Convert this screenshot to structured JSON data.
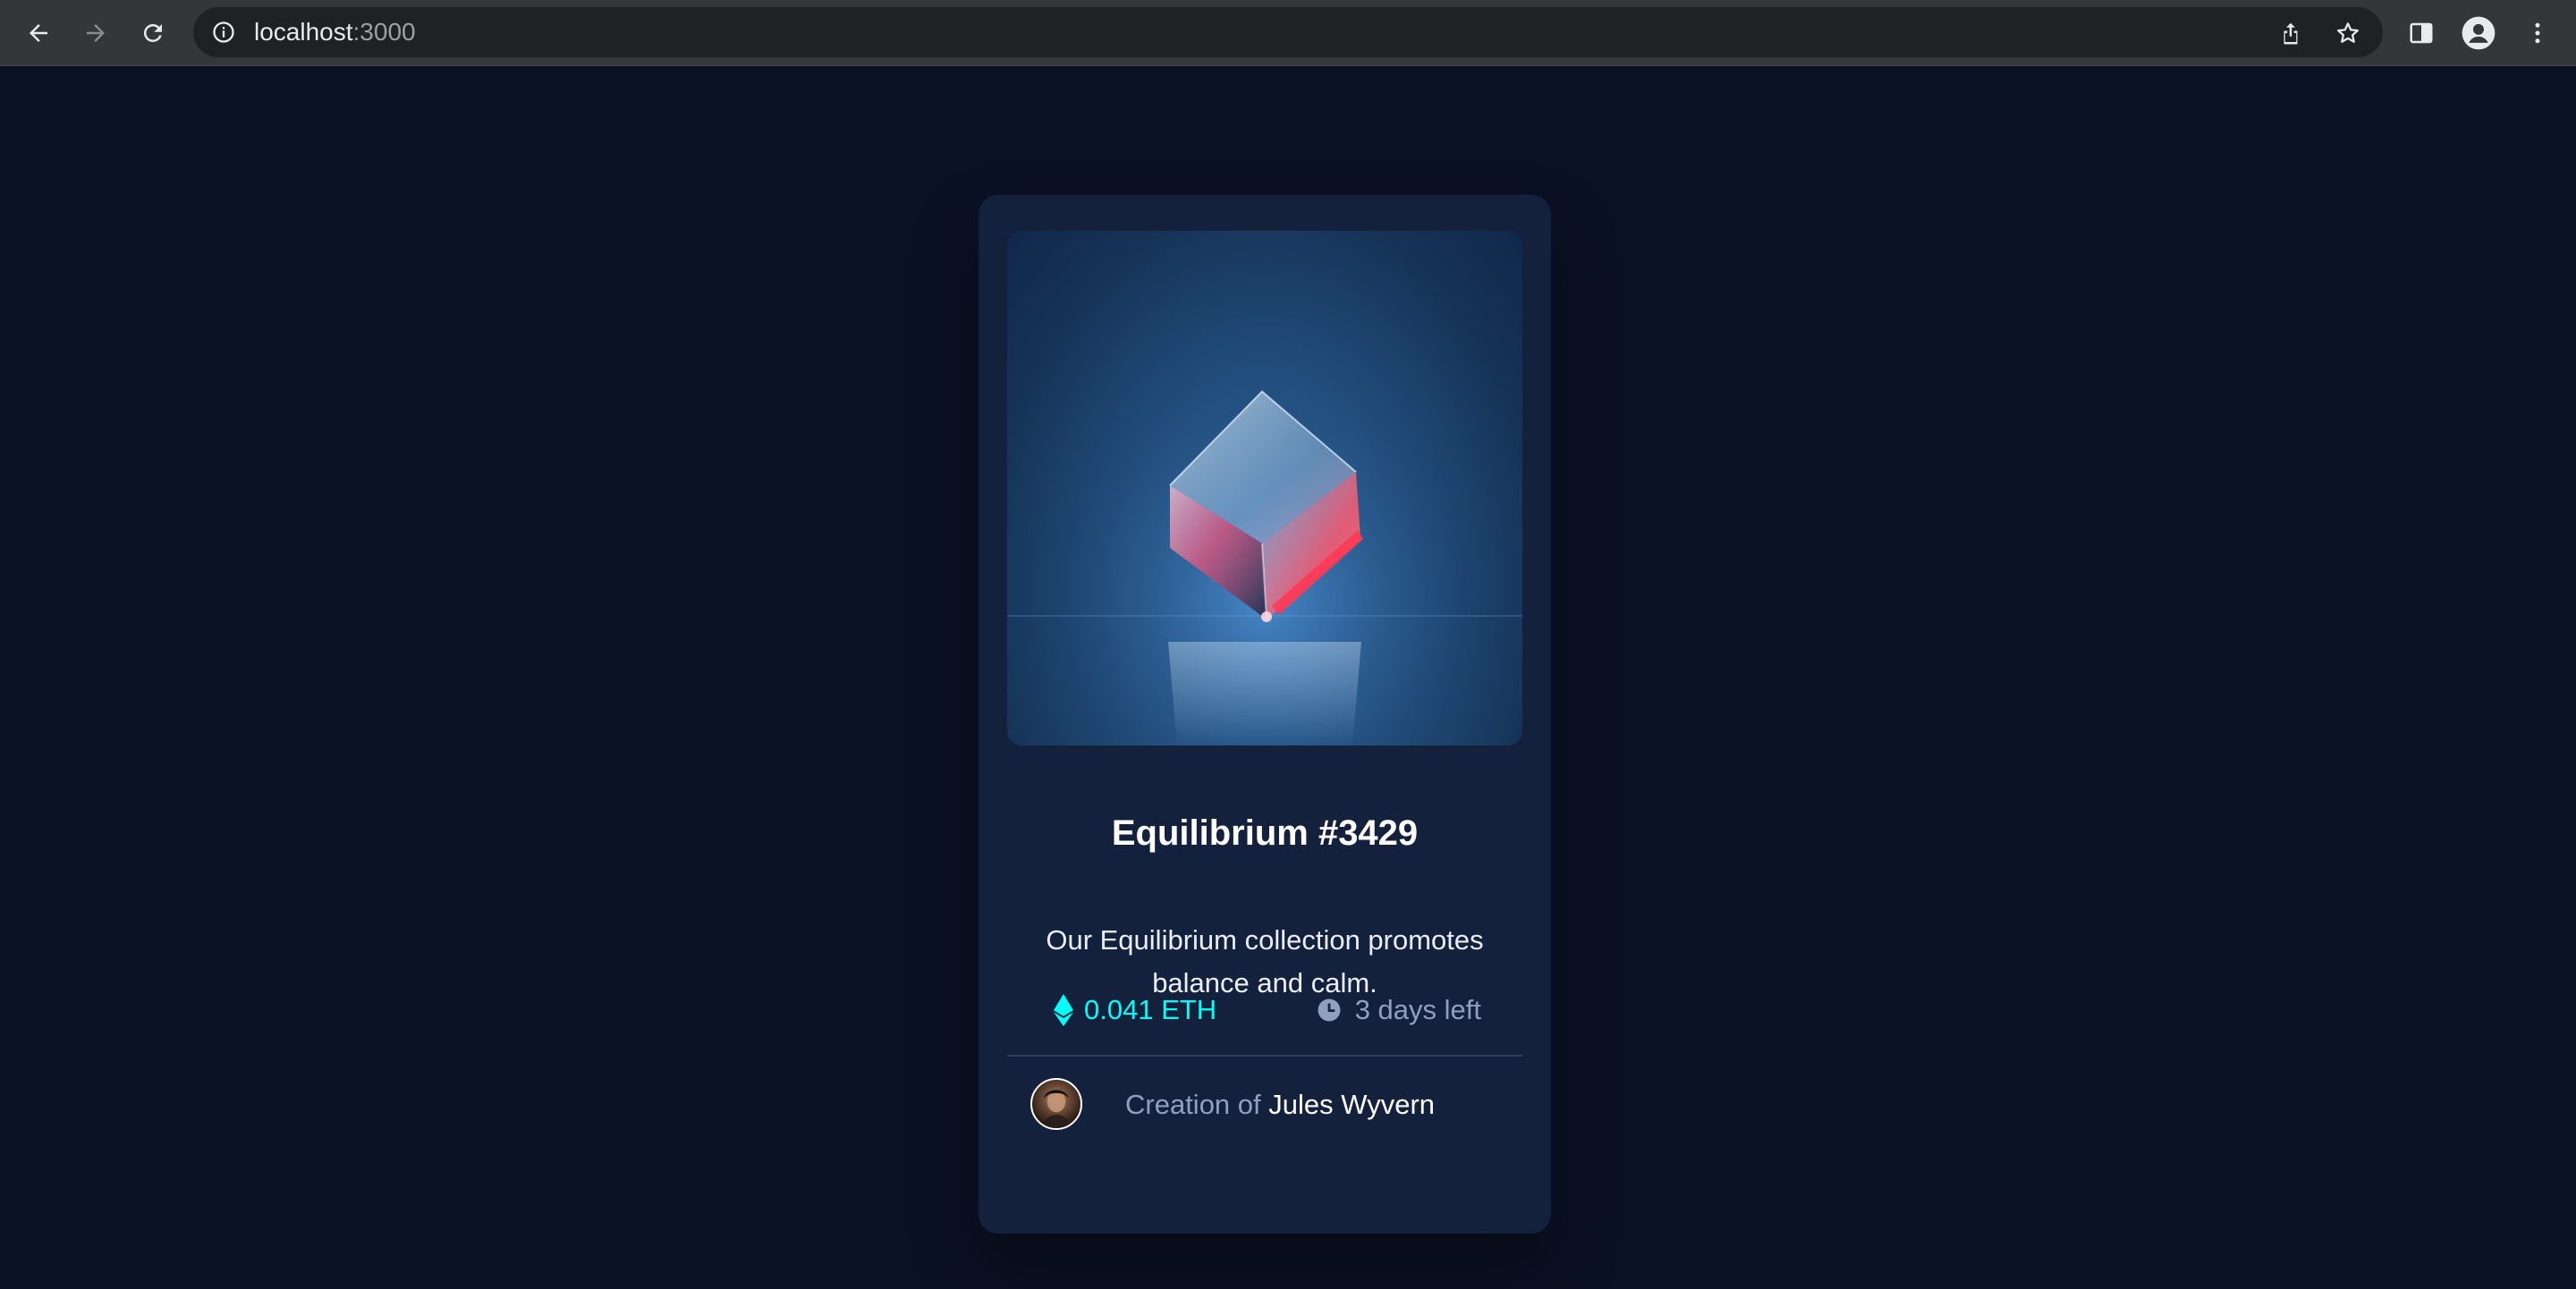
{
  "browser": {
    "url_host": "localhost",
    "url_port": ":3000",
    "icons": {
      "back": "arrow-left-icon",
      "forward": "arrow-right-icon",
      "reload": "reload-icon",
      "site_info": "info-icon",
      "share": "share-icon",
      "bookmark": "star-icon",
      "side_panel": "side-panel-icon",
      "profile": "profile-icon",
      "menu": "kebab-menu-icon"
    }
  },
  "card": {
    "title": "Equilibrium #3429",
    "description": "Our Equilibrium collection promotes balance and calm.",
    "price": "0.041 ETH",
    "time_left": "3 days left",
    "creator_prefix": "Creation of",
    "creator_name": "Jules Wyvern",
    "icons": {
      "price": "ethereum-icon",
      "time": "clock-icon"
    },
    "colors": {
      "page_background": "#0b1124",
      "card_background": "#14213d",
      "accent_cyan": "#00fff8",
      "muted_text": "#8fa0bd",
      "divider": "#2e3d5c"
    }
  }
}
